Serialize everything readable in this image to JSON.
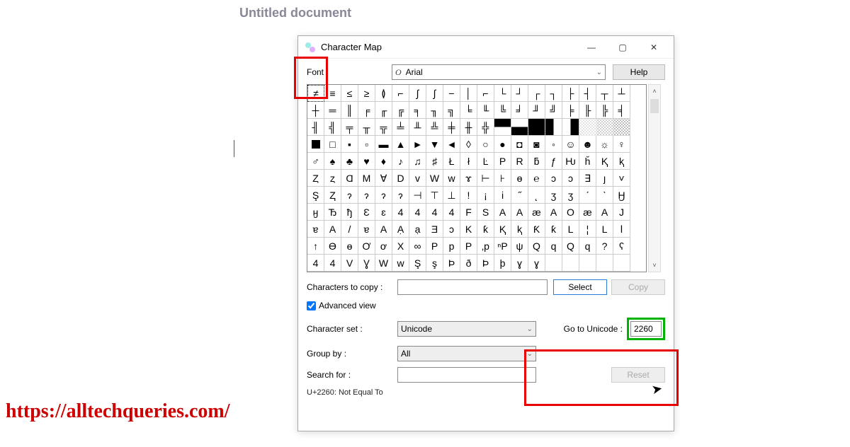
{
  "background": {
    "doc_title": "Untitled document",
    "watermark": "https://alltechqueries.com/"
  },
  "window": {
    "title": "Character Map",
    "font_label": "Font :",
    "font_value": "Arial",
    "help_label": "Help",
    "copy_label": "Characters to copy :",
    "select_btn": "Select",
    "copy_btn": "Copy",
    "advanced_view_label": "Advanced view",
    "advanced_view_checked": true,
    "charset_label": "Character set :",
    "charset_value": "Unicode",
    "groupby_label": "Group by :",
    "groupby_value": "All",
    "goto_label": "Go to Unicode :",
    "goto_value": "2260",
    "search_label": "Search for :",
    "reset_btn": "Reset",
    "status": "U+2260: Not Equal To"
  },
  "selected_char": "≠",
  "char_grid": [
    "≠",
    "≡",
    "≤",
    "≥",
    "≬",
    "⌐",
    "∫",
    "∫",
    "−",
    "│",
    "⌐",
    "└",
    "┘",
    "┌",
    "┐",
    "├",
    "┤",
    "┬",
    "┴",
    "┼",
    "═",
    "║",
    "╒",
    "╓",
    "╔",
    "╕",
    "╖",
    "╗",
    "╘",
    "╙",
    "╚",
    "╛",
    "╜",
    "╝",
    "╞",
    "╟",
    "╠",
    "╡",
    "╢",
    "╣",
    "╤",
    "╥",
    "╦",
    "╧",
    "╨",
    "╩",
    "╪",
    "╫",
    "╬",
    "▀",
    "▄",
    "█",
    "▌",
    "▐",
    "░",
    "▒",
    "▓",
    "■",
    "□",
    "▪",
    "▫",
    "▬",
    "▲",
    "►",
    "▼",
    "◄",
    "◊",
    "○",
    "●",
    "◘",
    "◙",
    "◦",
    "☺",
    "☻",
    "☼",
    "♀",
    "♂",
    "♠",
    "♣",
    "♥",
    "♦",
    "♪",
    "♫",
    "♯",
    "Ł",
    "ł",
    "Ŀ",
    "P",
    "R",
    "ƃ",
    "ƒ",
    "Ƕ",
    "ȟ",
    "Ⱪ",
    "ⱪ",
    "Ȥ",
    "ȥ",
    "Ɑ",
    "M",
    "∀",
    "D",
    "v",
    "W",
    "w",
    "ɤ",
    "⊢",
    "⊦",
    "ɵ",
    "℮",
    "ɔ",
    "ɔ",
    "∃",
    "ȷ",
    "˅",
    "Ş",
    "Ⱬ",
    "ɂ",
    "ɂ",
    "ɂ",
    "ɂ",
    "⊣",
    "⊤",
    "⊥",
    "ǃ",
    "¡",
    "і",
    "˝",
    "˛",
    "ʒ",
    "ʒ",
    "ˊ",
    "ˋ",
    "Ӈ",
    "ӈ",
    "Ђ",
    "ђ",
    "Ɛ",
    "ɛ",
    "4",
    "4",
    "4",
    "4",
    "F",
    "S",
    "A",
    "A",
    "æ",
    "A",
    "O",
    "æ",
    "A",
    "J",
    "ɐ",
    "A",
    "/",
    "ɐ",
    "A",
    "Ạ",
    "ạ",
    "Ǝ",
    "ɔ",
    "K",
    "ƙ",
    "Ⱪ",
    "ⱪ",
    "Ƙ",
    "ƙ",
    "L",
    "¦",
    "L",
    "ⅼ",
    "↑",
    "Ɵ",
    "ɵ",
    "Ơ",
    "ơ",
    "X",
    "∞",
    "P",
    "p",
    "P",
    "‚p",
    "ⁿP",
    "ψ",
    "Q",
    "q",
    "Q",
    "q",
    "?",
    "ʕ",
    "4",
    "4",
    "V",
    "Ɣ",
    "W",
    "w",
    "Ş",
    "ş",
    "Þ",
    "ð",
    "Þ",
    "þ",
    "ɣ",
    "ɣ"
  ]
}
